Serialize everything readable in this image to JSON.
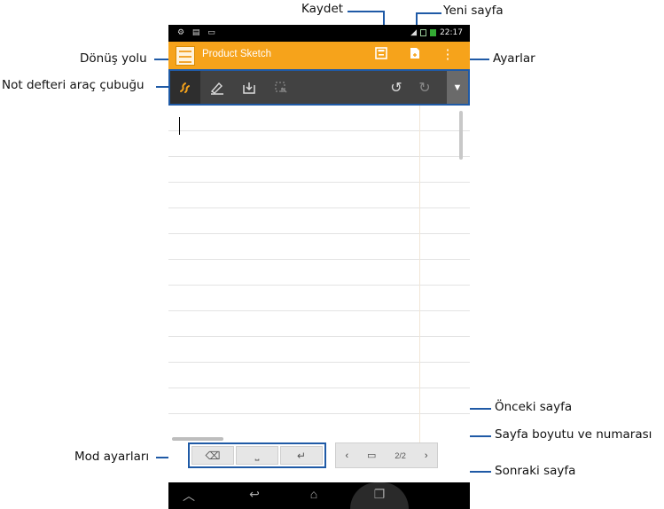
{
  "callouts": {
    "save": "Kaydet",
    "new_page": "Yeni sayfa",
    "return_path": "Dönüş yolu",
    "settings": "Ayarlar",
    "notebook_toolbar": "Not defteri araç çubuğu",
    "previous_page": "Önceki sayfa",
    "page_size_number": "Sayfa boyutu ve numarası",
    "mode_settings": "Mod ayarları",
    "next_page": "Sonraki sayfa"
  },
  "statusbar": {
    "time": "22:17"
  },
  "appbar": {
    "title": "Product Sketch"
  },
  "pagenav": {
    "page_indicator": "2/2"
  },
  "icons": {
    "save": "save-icon",
    "new_page": "new-page-icon",
    "overflow": "overflow-menu-icon",
    "handwrite": "handwrite-icon",
    "pen": "pen-icon",
    "insert": "insert-icon",
    "select": "select-icon",
    "undo": "undo-icon",
    "redo": "redo-icon",
    "backspace": "backspace-icon",
    "space": "space-icon",
    "enter": "enter-icon"
  },
  "colors": {
    "accent": "#f6a31b",
    "toolbar": "#424242",
    "callout_line": "#1f5aa6"
  }
}
